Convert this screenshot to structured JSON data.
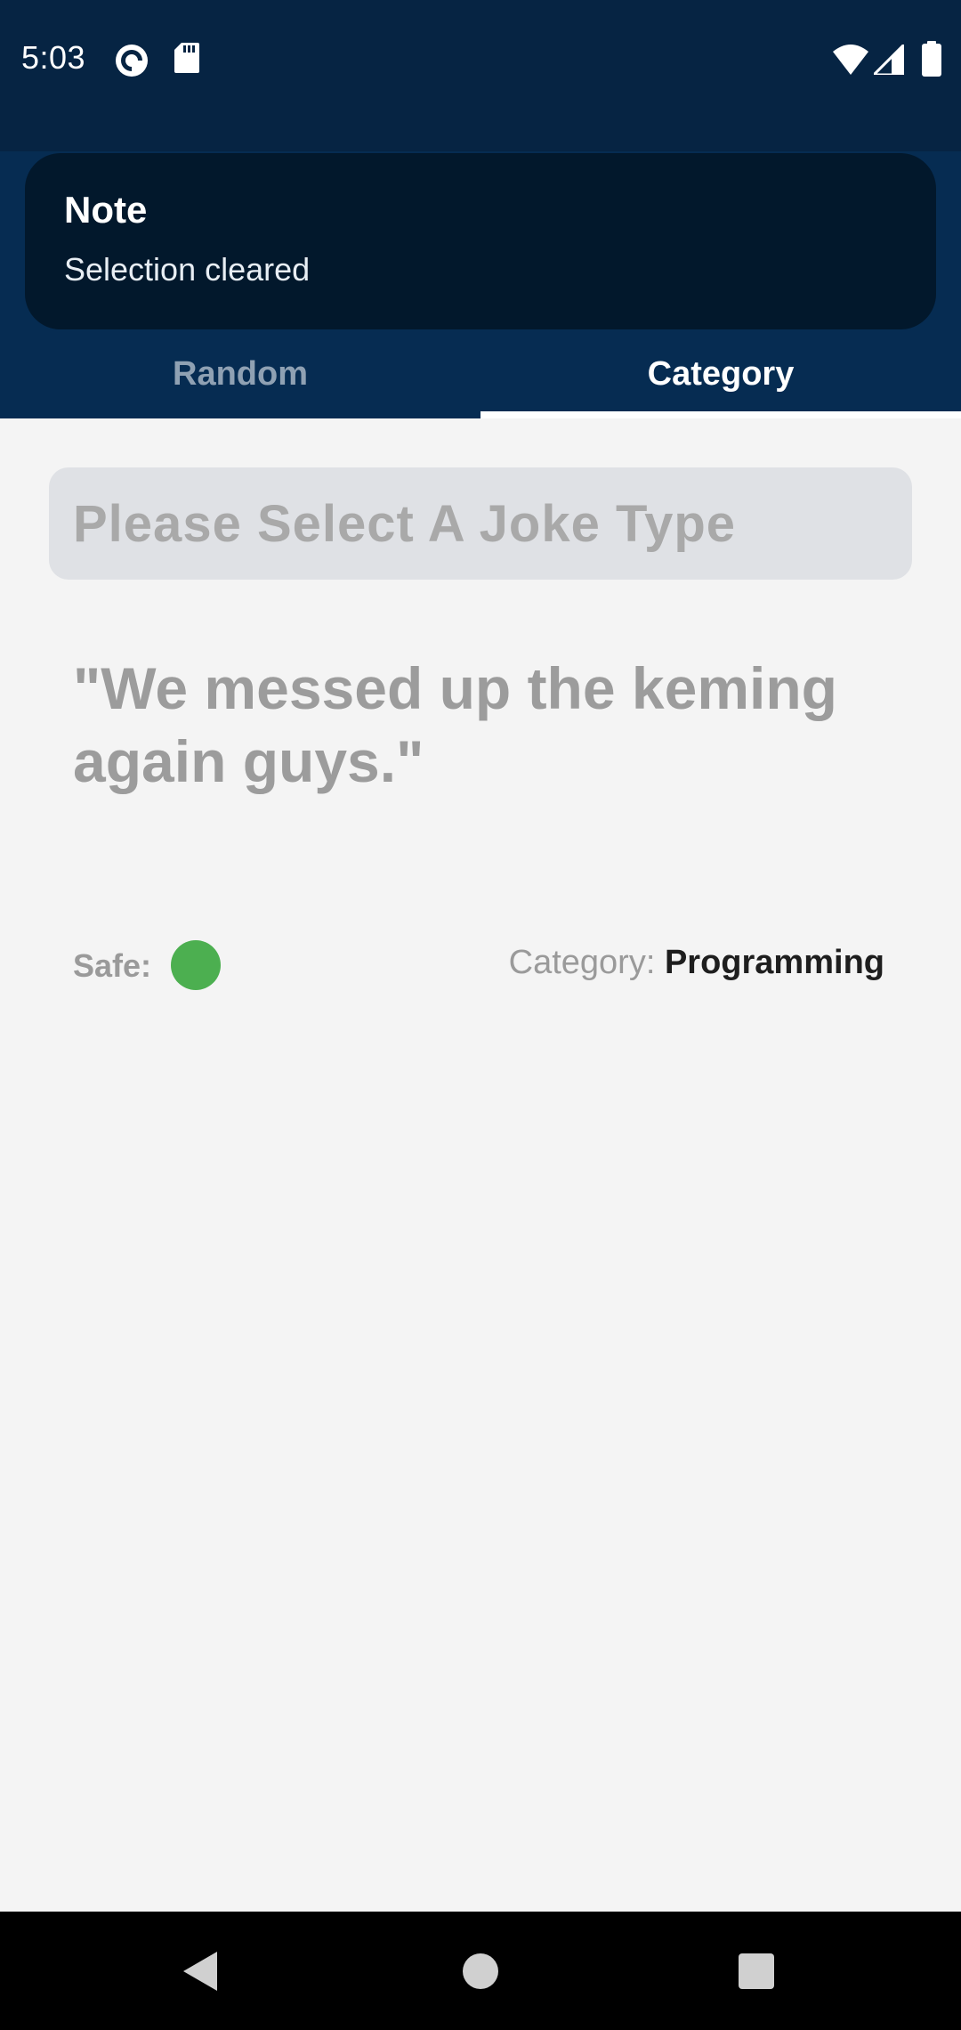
{
  "status_bar": {
    "time": "5:03",
    "left_icons": [
      "pocket-casts-icon",
      "sd-card-icon"
    ],
    "right_icons": [
      "wifi-icon",
      "cellular-signal-icon",
      "battery-icon"
    ]
  },
  "snackbar": {
    "title": "Note",
    "message": "Selection cleared"
  },
  "tabs": [
    {
      "label": "Random",
      "active": false
    },
    {
      "label": "Category",
      "active": true
    }
  ],
  "selector": {
    "placeholder": "Please Select A Joke Type"
  },
  "joke": {
    "text": "\"We messed up the keming again guys.\"",
    "safe_label": "Safe:",
    "safe": true,
    "category_label": "Category:",
    "category_value": "Programming"
  },
  "colors": {
    "status_bar": "#062443",
    "app_bar": "#062c52",
    "snackbar": "#02182c",
    "safe_indicator": "#4caf50"
  },
  "nav_bar": {
    "buttons": [
      "back-icon",
      "home-icon",
      "recents-icon"
    ]
  }
}
